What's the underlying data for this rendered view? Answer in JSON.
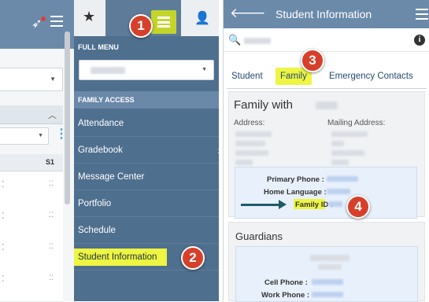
{
  "full_menu": {
    "heading": "FULL MENU",
    "section_heading": "FAMILY ACCESS",
    "items": [
      {
        "label": "Attendance"
      },
      {
        "label": "Gradebook",
        "has_arrow": true
      },
      {
        "label": "Message Center"
      },
      {
        "label": "Portfolio"
      },
      {
        "label": "Schedule"
      },
      {
        "label": "Student Information",
        "highlighted": true
      }
    ]
  },
  "grades_panel": {
    "column_header": "S1"
  },
  "student_info": {
    "title": "Student Information",
    "tabs": [
      {
        "label": "Student"
      },
      {
        "label": "Family",
        "highlighted": true
      },
      {
        "label": "Emergency Contacts"
      }
    ],
    "family_heading": "Family with",
    "address_label": "Address:",
    "mailing_address_label": "Mailing Address:",
    "primary_phone_label": "Primary Phone :",
    "home_language_label": "Home Language :",
    "family_id_label": "Family ID :",
    "guardians_heading": "Guardians",
    "cell_phone_label": "Cell Phone :",
    "work_phone_label": "Work Phone :"
  },
  "callouts": [
    "1",
    "2",
    "3",
    "4"
  ],
  "colors": {
    "menu_bg": "#4f6f8f",
    "header_bg": "#6b8aaa",
    "highlight": "#eef542",
    "badge": "#d6402a",
    "active_list_icon": "#c3d52a"
  }
}
